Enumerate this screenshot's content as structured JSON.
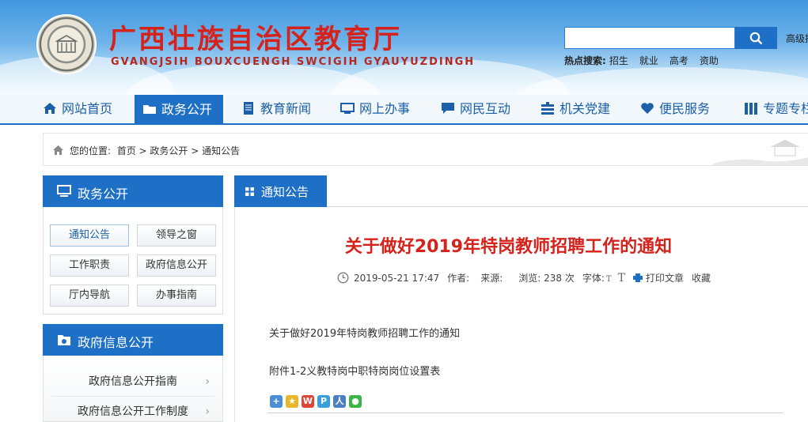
{
  "header": {
    "title": "广西壮族自治区教育厅",
    "subtitle": "GVANGJSIH BOUXCUENGH SWCIGIH GYAUYUZDINGH",
    "search_placeholder": "",
    "advanced_search": "高级搜",
    "hot_label": "热点搜索:",
    "hot_terms": [
      "招生",
      "就业",
      "高考",
      "资助"
    ]
  },
  "nav": {
    "items": [
      "网站首页",
      "政务公开",
      "教育新闻",
      "网上办事",
      "网民互动",
      "机关党建",
      "便民服务",
      "专题专栏"
    ],
    "active_index": 1
  },
  "breadcrumb": {
    "prefix": "您的位置:",
    "path": [
      "首页",
      "政务公开",
      "通知公告"
    ],
    "separator": ">"
  },
  "sidebar": {
    "section1_title": "政务公开",
    "grid": [
      "通知公告",
      "领导之窗",
      "工作职责",
      "政府信息公开",
      "厅内导航",
      "办事指南"
    ],
    "section2_title": "政府信息公开",
    "list": [
      "政府信息公开指南",
      "政府信息公开工作制度"
    ]
  },
  "main": {
    "tab": "通知公告",
    "article_title": "关于做好2019年特岗教师招聘工作的通知",
    "meta": {
      "datetime": "2019-05-21 17:47",
      "author_label": "作者:",
      "source_label": "来源:",
      "views_label": "浏览:",
      "views_value": "238",
      "views_unit": "次",
      "font_label": "字体:",
      "print": "打印文章",
      "favorite": "收藏"
    },
    "body_line1": "关于做好2019年特岗教师招聘工作的通知",
    "body_line2": "附件1-2义教特岗中职特岗岗位设置表"
  },
  "colors": {
    "brand_blue": "#1e6fc6",
    "title_red": "#d5221b"
  }
}
